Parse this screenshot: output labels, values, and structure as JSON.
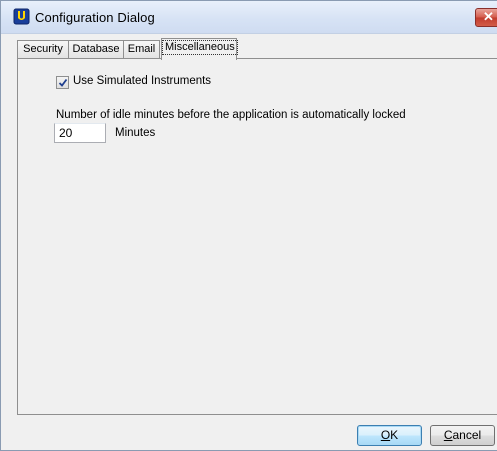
{
  "window": {
    "title": "Configuration Dialog",
    "close_glyph": "✕"
  },
  "tabs": [
    {
      "label": "Security",
      "active": false
    },
    {
      "label": "Database",
      "active": false
    },
    {
      "label": "Email",
      "active": false
    },
    {
      "label": "Miscellaneous",
      "active": true
    }
  ],
  "misc": {
    "use_simulated_label": "Use Simulated Instruments",
    "use_simulated_checked": true,
    "idle_label": "Number of idle minutes before the application is automatically locked",
    "idle_minutes_value": "20",
    "minutes_unit": "Minutes"
  },
  "buttons": {
    "ok_mnemonic": "O",
    "ok_rest": "K",
    "cancel_mnemonic": "C",
    "cancel_rest": "ancel"
  },
  "colors": {
    "accent_blue": "#1f4aa0",
    "check_color": "#1f3f8f",
    "close_red": "#c13b2d"
  },
  "icons": {
    "app": "shield-u-icon",
    "close": "close-icon",
    "check": "checkmark-icon"
  }
}
